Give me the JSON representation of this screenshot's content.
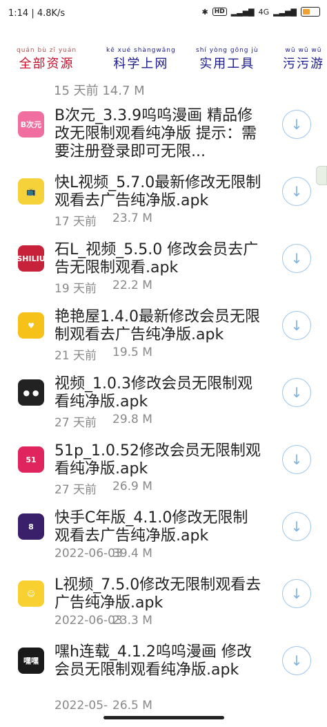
{
  "status": {
    "left": "1:14 | 4.8K/s",
    "network": "HD",
    "signal": "4G"
  },
  "nav": {
    "tabs": [
      {
        "pinyin": "quán bù zī yuán",
        "label": "全部资源"
      },
      {
        "pinyin": "kē xué shàngwǎng",
        "label": "科学上网"
      },
      {
        "pinyin": "shí yòng gōng jù",
        "label": "实用工具"
      },
      {
        "pinyin": "wū wū wū",
        "label": "污污游"
      }
    ]
  },
  "list": {
    "partial_meta": "15 天前   14.7 M",
    "items": [
      {
        "title": "B次元_3.3.9呜呜漫画 精品修改无限制观看纯净版 提示：需要注册登录即可无限...",
        "date": "",
        "size": "",
        "icon": "bciyuan-icon",
        "icon_text": "B次元"
      },
      {
        "title": "快L视频_5.7.0最新修改无限制观看去广告纯净版.apk",
        "date": "17 天前",
        "size": "23.7 M",
        "icon": "tv-icon",
        "icon_text": "📺"
      },
      {
        "title": "石L_视频_5.5.0 修改会员去广告无限制观看.apk",
        "date": "19 天前",
        "size": "22.2 M",
        "icon": "shiliu-icon",
        "icon_text": "SHILIU"
      },
      {
        "title": "艳艳屋1.4.0最新修改会员无限制观看去广告纯净版.apk",
        "date": "21 天前",
        "size": "19.5 M",
        "icon": "yanyanwu-icon",
        "icon_text": "♥"
      },
      {
        "title": "视频_1.0.3修改会员无限制观看纯净版.apk",
        "date": "27 天前",
        "size": "29.8 M",
        "icon": "cat-icon",
        "icon_text": "● ●"
      },
      {
        "title": "51p_1.0.52修改会员无限制观看纯净版.apk",
        "date": "27 天前",
        "size": "26.9 M",
        "icon": "51p-icon",
        "icon_text": "51"
      },
      {
        "title": "快手C年版_4.1.0修改无限制观看去广告纯净版.apk",
        "date": "2022-06-03",
        "size": "39.4 M",
        "icon": "kuaishou-icon",
        "icon_text": "8"
      },
      {
        "title": "L视频_7.5.0修改无限制观看去广告纯净版.apk",
        "date": "2022-06-03",
        "size": "23.3 M",
        "icon": "lshipin-icon",
        "icon_text": "☺"
      },
      {
        "title": "嘿h连载_4.1.2呜呜漫画 修改会员无限制观看纯净版.apk",
        "date": "2022-05-",
        "size": "26.5 M",
        "icon": "heih-icon",
        "icon_text": "嘿嘿"
      }
    ]
  },
  "colors": {
    "download_ring": "#9cc6ec",
    "tab_active": "#c8102e",
    "tab_inactive": "#1a1a8c"
  }
}
